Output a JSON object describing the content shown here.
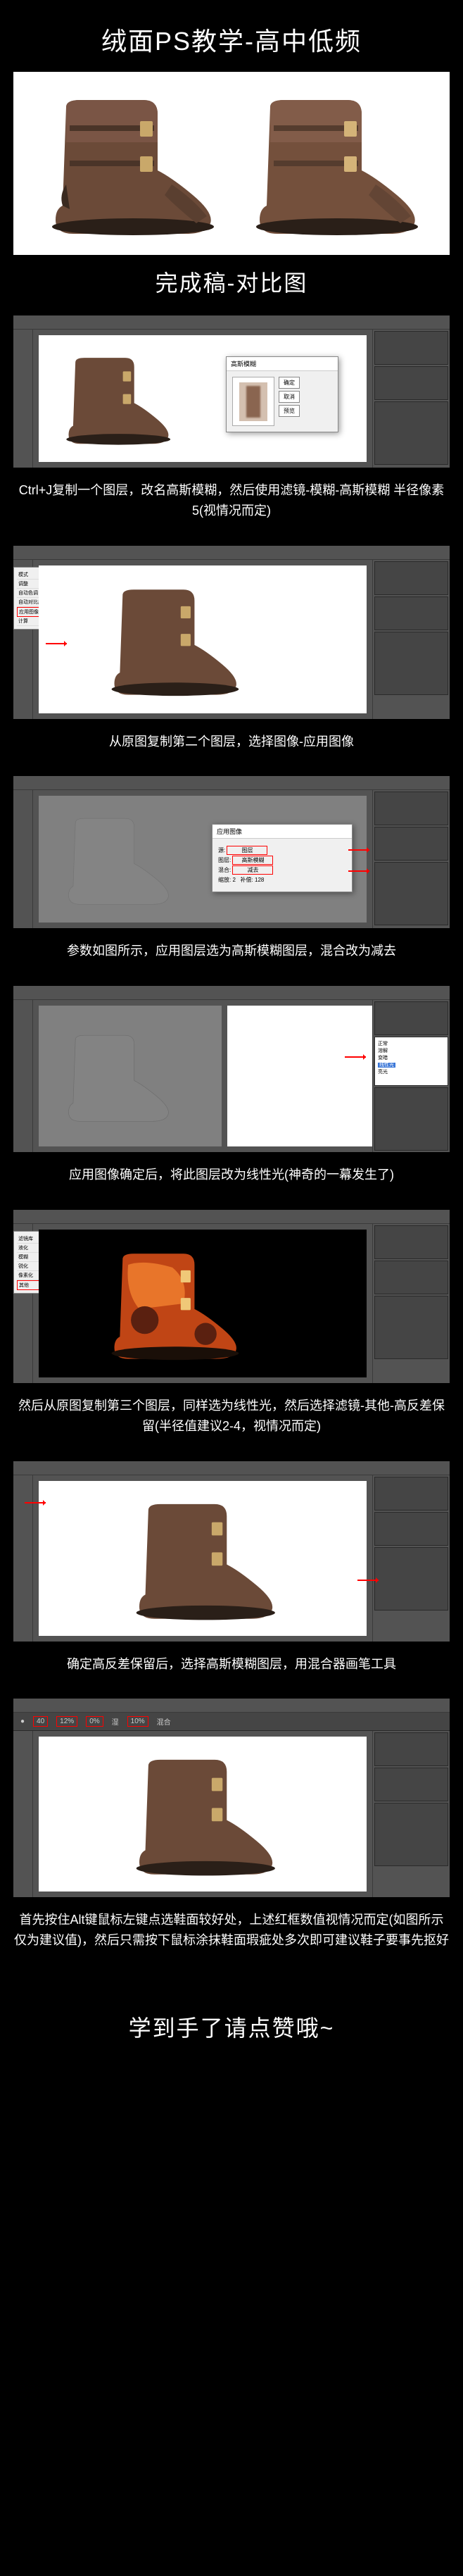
{
  "title": "绒面PS教学-高中低频",
  "subtitle": "完成稿-对比图",
  "footer": "学到手了请点赞哦~",
  "steps": [
    {
      "caption": "Ctrl+J复制一个图层，改名高斯模糊，然后使用滤镜-模糊-高斯模糊 半径像素5(视情况而定)",
      "dialog_title": "高斯模糊",
      "btn_ok": "确定",
      "btn_cancel": "取消",
      "btn_preview": "预览"
    },
    {
      "caption": "从原图复制第二个图层，选择图像-应用图像"
    },
    {
      "caption": "参数如图所示，应用图层选为高斯模糊图层，混合改为减去",
      "dialog_title": "应用图像"
    },
    {
      "caption": "应用图像确定后，将此图层改为线性光(神奇的一幕发生了)"
    },
    {
      "caption": "然后从原图复制第三个图层，同样选为线性光，然后选择滤镜-其他-高反差保留(半径值建议2-4，视情况而定)"
    },
    {
      "caption": "确定高反差保留后，选择高斯模糊图层，用混合器画笔工具"
    },
    {
      "caption": "首先按住Alt键鼠标左键点选鞋面较好处，上述红框数值视情况而定(如图所示仅为建议值)，然后只需按下鼠标涂抹鞋面瑕疵处多次即可建议鞋子要事先抠好",
      "opts": [
        "40",
        "12%",
        "0%",
        "湿",
        "10%",
        "混合"
      ]
    }
  ]
}
